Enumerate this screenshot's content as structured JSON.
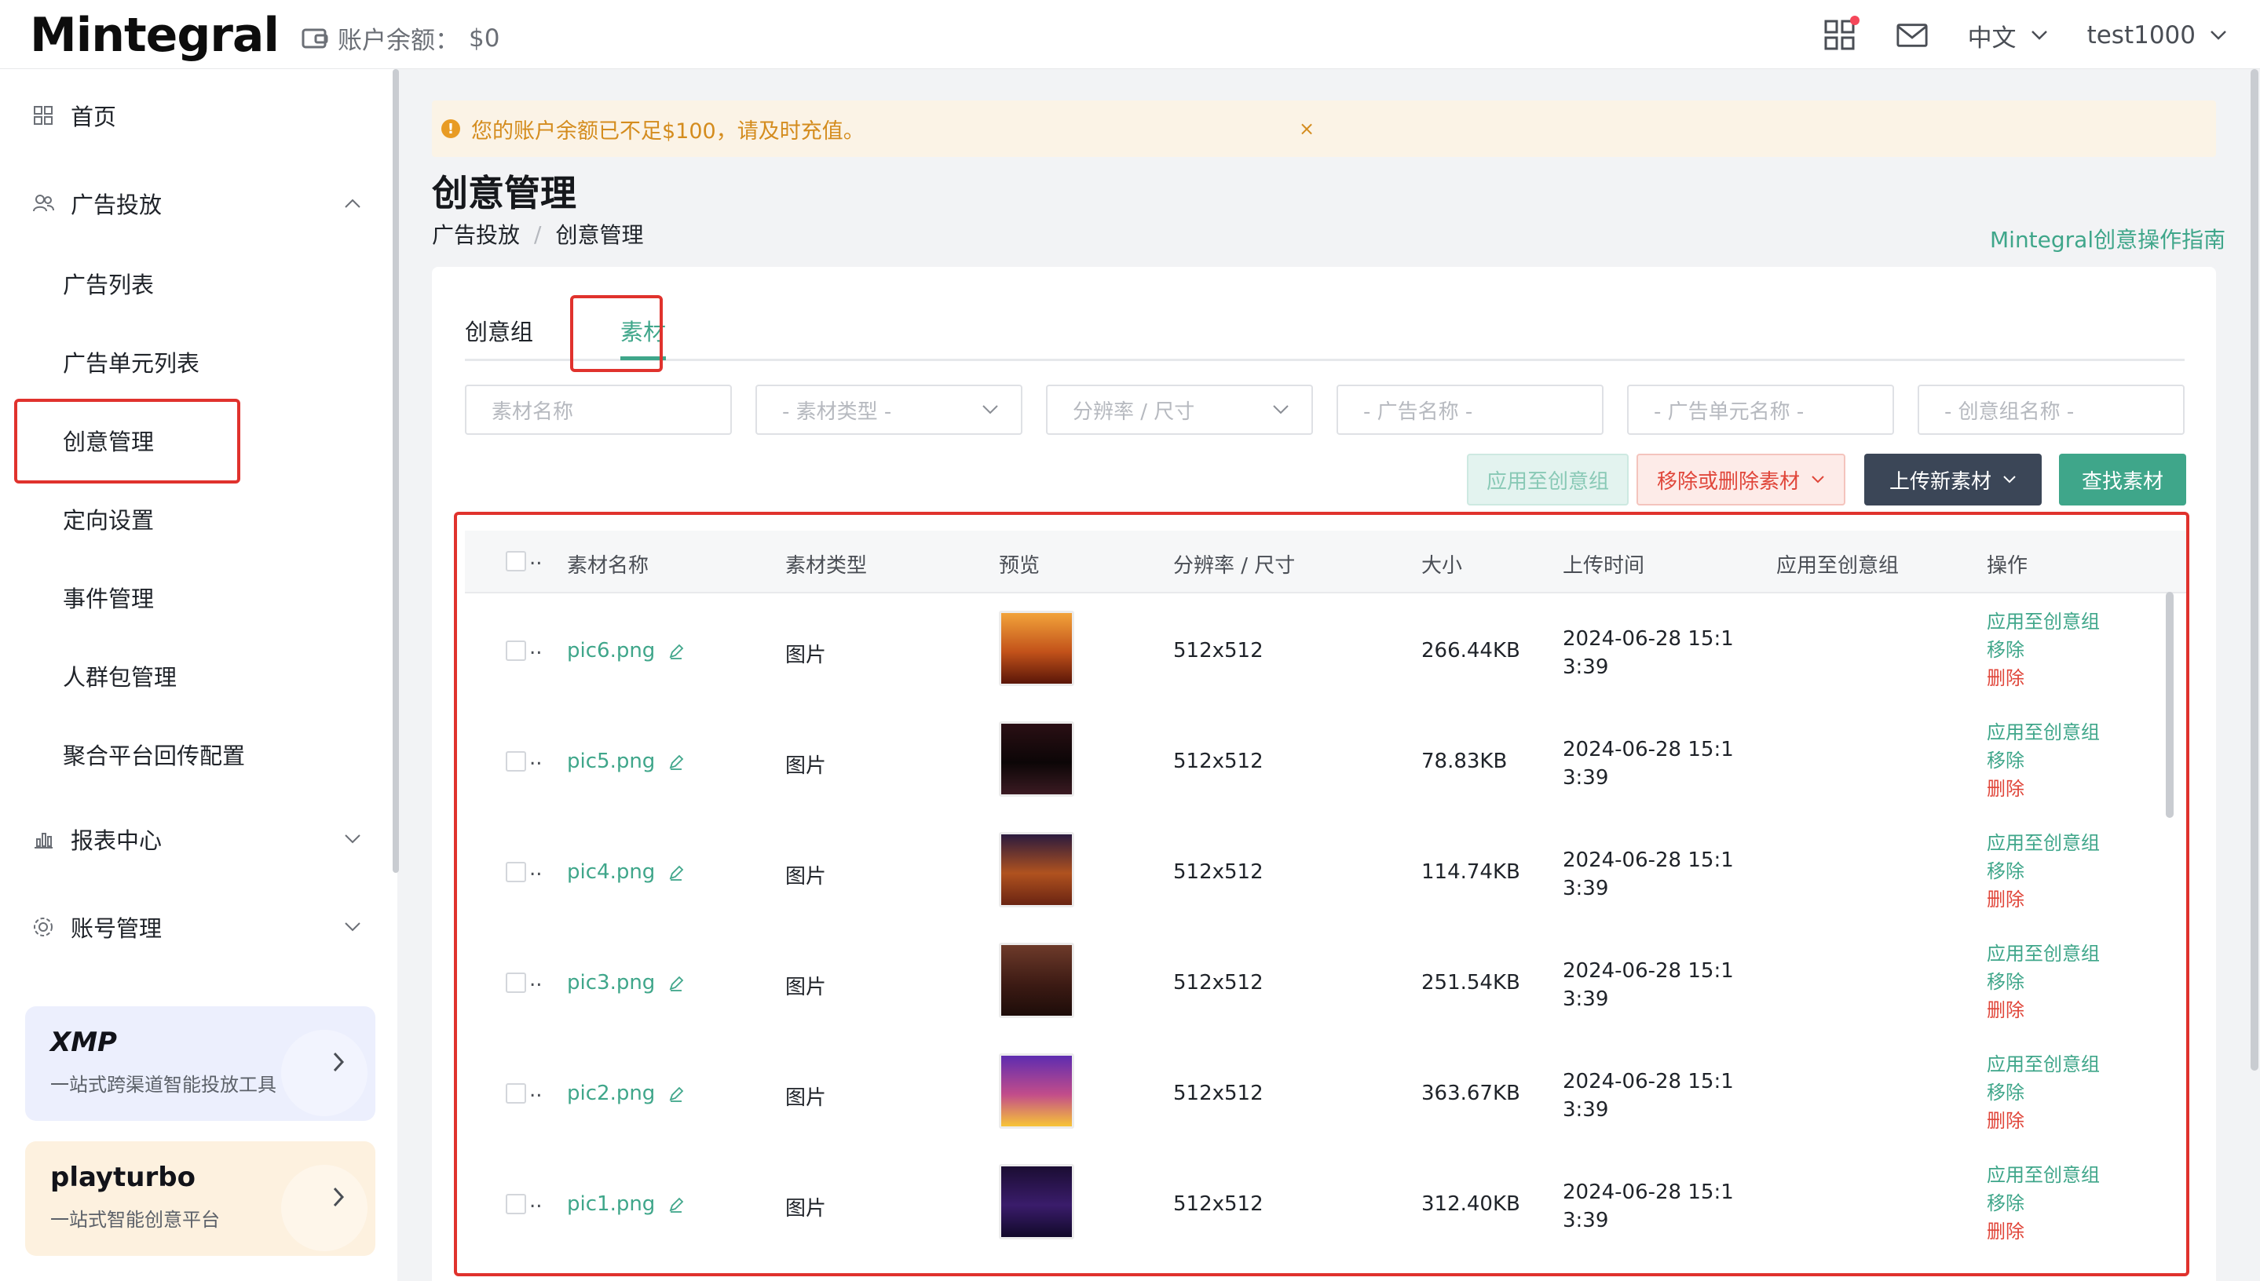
{
  "header": {
    "logo": "Mintegral",
    "balance_label": "账户余额：",
    "balance_value": "$0",
    "language": "中文",
    "username": "test1000",
    "icons": [
      "wallet-icon",
      "apps-grid-icon",
      "mail-icon",
      "chevron-down-icon"
    ]
  },
  "sidebar": {
    "items": [
      {
        "label": "首页",
        "icon": "home-grid-icon"
      },
      {
        "label": "广告投放",
        "icon": "users-icon",
        "expanded": true
      },
      {
        "label": "广告列表"
      },
      {
        "label": "广告单元列表"
      },
      {
        "label": "创意管理",
        "active": true
      },
      {
        "label": "定向设置"
      },
      {
        "label": "事件管理"
      },
      {
        "label": "人群包管理"
      },
      {
        "label": "聚合平台回传配置"
      },
      {
        "label": "报表中心",
        "icon": "chart-icon"
      },
      {
        "label": "账号管理",
        "icon": "gear-icon"
      }
    ],
    "promos": [
      {
        "brand": "XMP",
        "desc": "一站式跨渠道智能投放工具",
        "color": "#eceffd"
      },
      {
        "brand": "playturbo",
        "desc": "一站式智能创意平台",
        "color": "#fdf1df"
      }
    ]
  },
  "alert": {
    "message": "您的账户余额已不足$100，请及时充值。",
    "close": "×"
  },
  "page": {
    "title": "创意管理",
    "breadcrumb": [
      "广告投放",
      "/",
      "创意管理"
    ],
    "guide_link": "Mintegral创意操作指南"
  },
  "tabs": [
    "创意组",
    "素材"
  ],
  "active_tab": "素材",
  "filters": [
    {
      "placeholder": "素材名称",
      "dropdown": false
    },
    {
      "placeholder": "- 素材类型 -",
      "dropdown": true
    },
    {
      "placeholder": "分辨率 / 尺寸",
      "dropdown": true
    },
    {
      "placeholder": "- 广告名称 -",
      "dropdown": false
    },
    {
      "placeholder": "- 广告单元名称 -",
      "dropdown": false
    },
    {
      "placeholder": "- 创意组名称 -",
      "dropdown": false
    }
  ],
  "actions": {
    "apply": "应用至创意组",
    "remove": "移除或删除素材",
    "upload": "上传新素材",
    "find": "查找素材"
  },
  "table": {
    "select_all_suffix": "..",
    "columns": [
      "素材名称",
      "素材类型",
      "预览",
      "分辨率 / 尺寸",
      "大小",
      "上传时间",
      "应用至创意组",
      "操作"
    ],
    "rows": [
      {
        "name": "pic6.png",
        "type": "图片",
        "resolution": "512x512",
        "size": "266.44KB",
        "time_line1": "2024-06-28 15:1",
        "time_line2": "3:39",
        "group": "",
        "thumb_colors": [
          "#f2a33a",
          "#c2521a",
          "#5a1608"
        ]
      },
      {
        "name": "pic5.png",
        "type": "图片",
        "resolution": "512x512",
        "size": "78.83KB",
        "time_line1": "2024-06-28 15:1",
        "time_line2": "3:39",
        "group": "",
        "thumb_colors": [
          "#2a0f14",
          "#0c0607",
          "#3b1a22"
        ]
      },
      {
        "name": "pic4.png",
        "type": "图片",
        "resolution": "512x512",
        "size": "114.74KB",
        "time_line1": "2024-06-28 15:1",
        "time_line2": "3:39",
        "group": "",
        "thumb_colors": [
          "#2b1a3e",
          "#b0521f",
          "#6a2412"
        ]
      },
      {
        "name": "pic3.png",
        "type": "图片",
        "resolution": "512x512",
        "size": "251.54KB",
        "time_line1": "2024-06-28 15:1",
        "time_line2": "3:39",
        "group": "",
        "thumb_colors": [
          "#6d3a2a",
          "#3d1b14",
          "#1d0c09"
        ]
      },
      {
        "name": "pic2.png",
        "type": "图片",
        "resolution": "512x512",
        "size": "363.67KB",
        "time_line1": "2024-06-28 15:1",
        "time_line2": "3:39",
        "group": "",
        "thumb_colors": [
          "#5e2cb0",
          "#c24d8a",
          "#f7c437"
        ]
      },
      {
        "name": "pic1.png",
        "type": "图片",
        "resolution": "512x512",
        "size": "312.40KB",
        "time_line1": "2024-06-28 15:1",
        "time_line2": "3:39",
        "group": "",
        "thumb_colors": [
          "#1b0d33",
          "#3a1c6b",
          "#12092a"
        ]
      }
    ],
    "row_ops": [
      "应用至创意组",
      "移除",
      "删除"
    ]
  },
  "colors": {
    "accent": "#3fa68a",
    "danger": "#e0463a",
    "highlight_frame": "#e0322d",
    "warning": "#e89b24"
  }
}
